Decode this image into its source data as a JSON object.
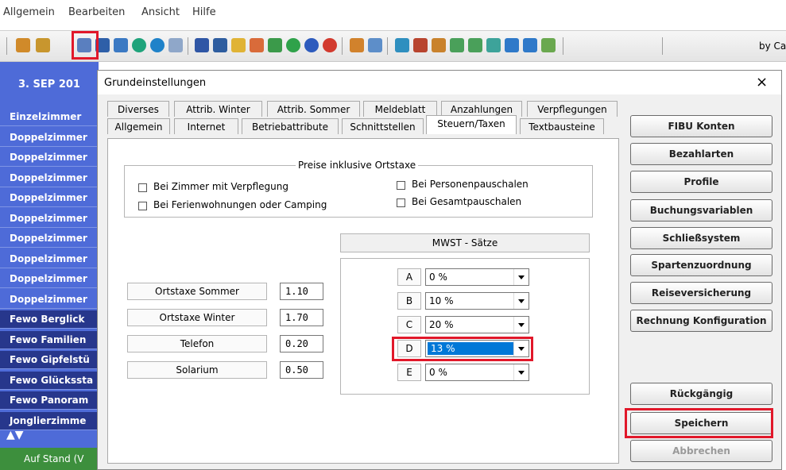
{
  "menu": {
    "items": [
      "Allgemein",
      "Bearbeiten",
      "Ansicht",
      "Hilfe"
    ]
  },
  "toolbar": {
    "right_text": "by Ca"
  },
  "background": {
    "date": "3. SEP 201",
    "rooms": [
      "Einzelzimmer",
      "Doppelzimmer",
      "Doppelzimmer",
      "Doppelzimmer",
      "Doppelzimmer",
      "Doppelzimmer",
      "Doppelzimmer",
      "Doppelzimmer",
      "Doppelzimmer",
      "Doppelzimmer",
      "Fewo Berglick",
      "Fewo Familien",
      "Fewo Gipfelstü",
      "Fewo Glückssta",
      "Fewo Panoram",
      "Jonglierzimme"
    ],
    "status": "Auf Stand (V"
  },
  "dialog": {
    "title": "Grundeinstellungen",
    "close": "×",
    "tabs_row1": [
      "Diverses",
      "Attrib. Winter",
      "Attrib. Sommer",
      "Meldeblatt",
      "Anzahlungen",
      "Verpflegungen"
    ],
    "tabs_row2": [
      "Allgemein",
      "Internet",
      "Betriebattribute",
      "Schnittstellen",
      "Steuern/Taxen",
      "Textbausteine"
    ],
    "active_tab": "Steuern/Taxen"
  },
  "prices_group": {
    "legend": "Preise inklusive Ortstaxe",
    "options": [
      "Bei Zimmer mit Verpflegung",
      "Bei Ferienwohnungen oder Camping",
      "Bei Personenpauschalen",
      "Bei Gesamtpauschalen"
    ]
  },
  "taxes": [
    {
      "label": "Ortstaxe Sommer",
      "value": "1.10"
    },
    {
      "label": "Ortstaxe Winter",
      "value": "1.70"
    },
    {
      "label": "Telefon",
      "value": "0.20"
    },
    {
      "label": "Solarium",
      "value": "0.50"
    }
  ],
  "vat": {
    "title": "MWST - Sätze",
    "rates": [
      {
        "letter": "A",
        "value": "0 %"
      },
      {
        "letter": "B",
        "value": "10 %"
      },
      {
        "letter": "C",
        "value": "20 %"
      },
      {
        "letter": "D",
        "value": "13 %"
      },
      {
        "letter": "E",
        "value": "0 %"
      }
    ]
  },
  "side_buttons": [
    "FIBU Konten",
    "Bezahlarten",
    "Profile",
    "Buchungsvariablen",
    "Schließsystem",
    "Spartenzuordnung",
    "Reiseversicherung",
    "Rechnung Konfiguration"
  ],
  "bottom_buttons": {
    "undo": "Rückgängig",
    "save": "Speichern",
    "cancel": "Abbrechen"
  },
  "colors": {
    "accent_blue": "#4e6bd8",
    "highlight_red": "#e1182a",
    "selection": "#0078d7"
  }
}
